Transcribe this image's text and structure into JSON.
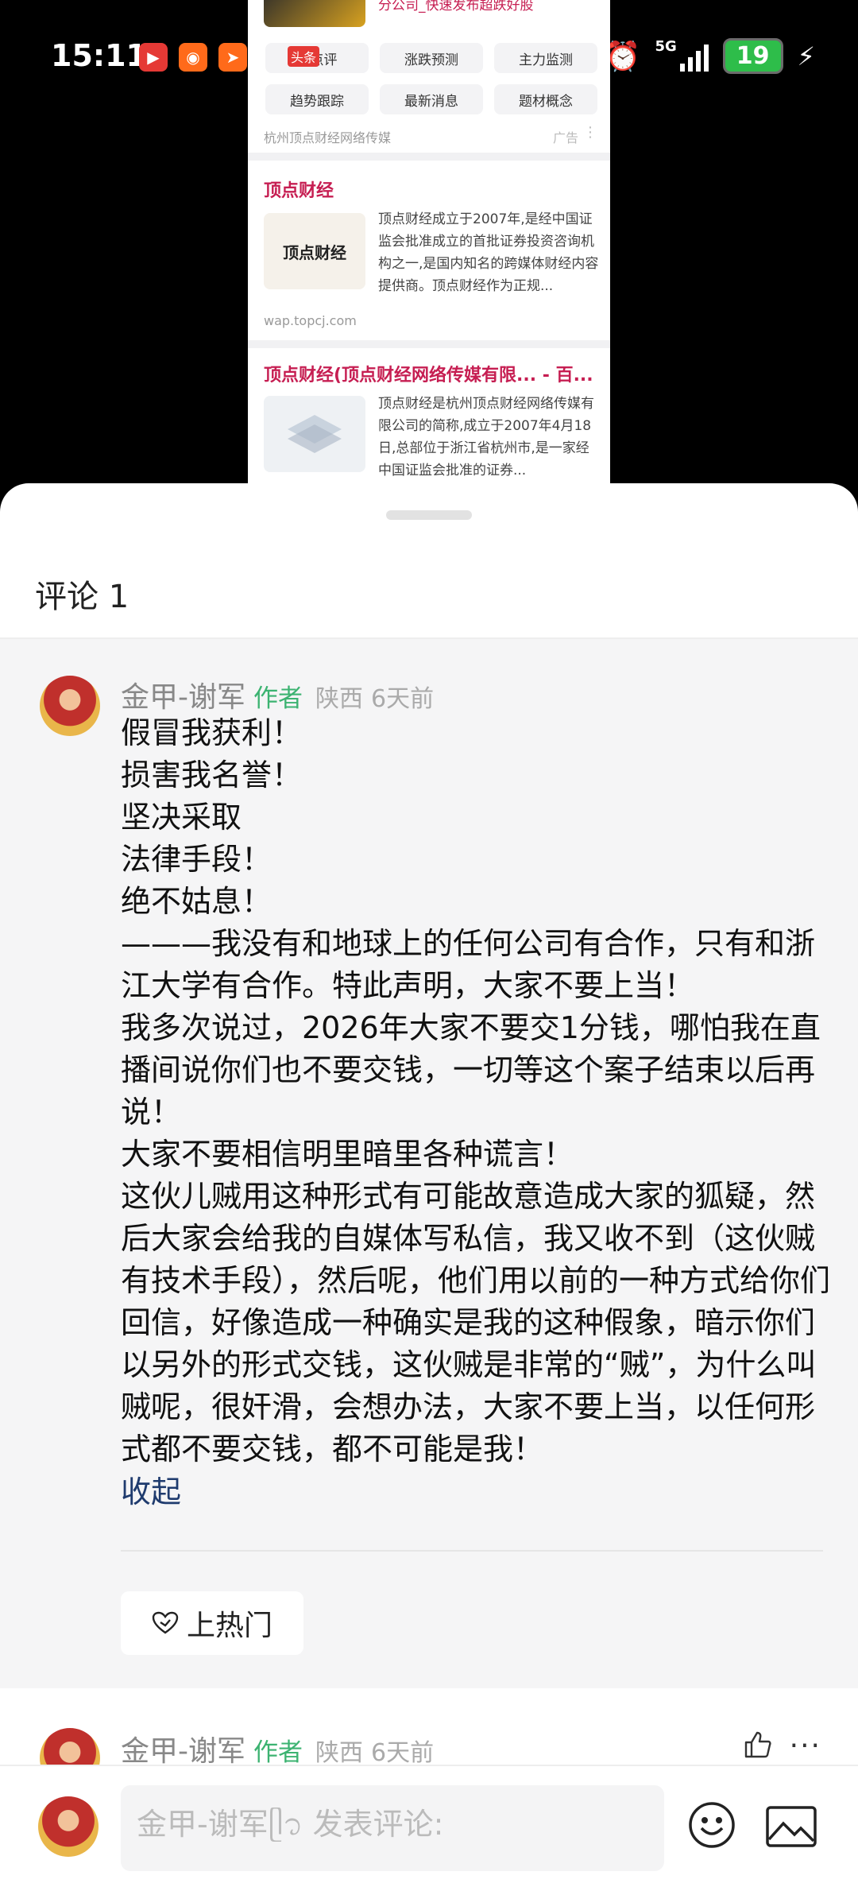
{
  "status_bar": {
    "time": "15:11",
    "network": "5G",
    "battery": "19",
    "app_icons": [
      "video-app-icon",
      "kuaishou-icon",
      "paper-plane-icon",
      "kuaishou-icon"
    ],
    "toutiao_label": "头条"
  },
  "video_frame": {
    "top_snippet": "分公司_快速发布超跌好股",
    "ad_tags": [
      "顶点评",
      "涨跌预测",
      "主力监测",
      "趋势跟踪",
      "最新消息",
      "题材概念"
    ],
    "ad_source": "杭州顶点财经网络传媒",
    "ad_label": "广告",
    "result1": {
      "title": "顶点财经",
      "thumb_text": "顶点财经",
      "description": "顶点财经成立于2007年,是经中国证监会批准成立的首批证券投资咨询机构之一,是国内知名的跨媒体财经内容提供商。顶点财经作为正规...",
      "url": "wap.topcj.com"
    },
    "result2": {
      "title": "顶点财经(顶点财经网络传媒有限... - 百...",
      "description": "顶点财经是杭州顶点财经网络传媒有限公司的简称,成立于2007年4月18日,总部位于浙江省杭州市,是一家经中国证监会批准的证券..."
    }
  },
  "comments": {
    "title": "评论 1",
    "first": {
      "author": "金甲-谢军",
      "badge": "作者",
      "location": "陕西",
      "time": "6天前",
      "lines": [
        "假冒我获利！",
        "损害我名誉！",
        "坚决采取",
        "法律手段！",
        "绝不姑息！",
        "———我没有和地球上的任何公司有合作，只有和浙江大学有合作。特此声明，大家不要上当！",
        "我多次说过，2026年大家不要交1分钱，哪怕我在直播间说你们也不要交钱，一切等这个案子结束以后再说！",
        "大家不要相信明里暗里各种谎言！",
        "这伙儿贼用这种形式有可能故意造成大家的狐疑，然后大家会给我的自媒体写私信，我又收不到（这伙贼有技术手段），然后呢，他们用以前的一种方式给你们回信，好像造成一种确实是我的这种假象，暗示你们以另外的形式交钱，这伙贼是非常的“贼”，为什么叫贼呢，很奸滑，会想办法，大家不要上当，以任何形式都不要交钱，都不可能是我！"
      ],
      "collapse_label": "收起",
      "hot_button_label": "上热门"
    },
    "second": {
      "author": "金甲-谢军",
      "badge": "作者",
      "location": "陕西",
      "time": "6天前"
    }
  },
  "input_bar": {
    "placeholder": "金甲-谢军ᥫ᭡ 发表评论:"
  }
}
